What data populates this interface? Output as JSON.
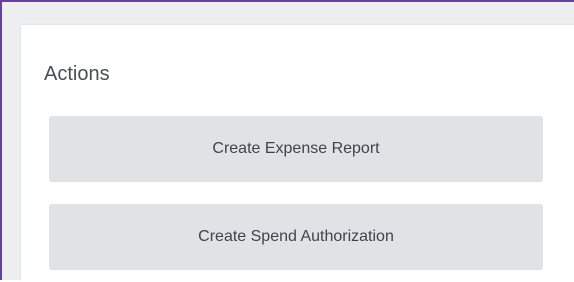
{
  "actions_panel": {
    "title": "Actions",
    "buttons": [
      {
        "label": "Create Expense Report"
      },
      {
        "label": "Create Spend Authorization"
      }
    ]
  },
  "colors": {
    "frame_border": "#6a3fa0",
    "button_background": "#dfe3e6",
    "text": "#3f4449"
  }
}
